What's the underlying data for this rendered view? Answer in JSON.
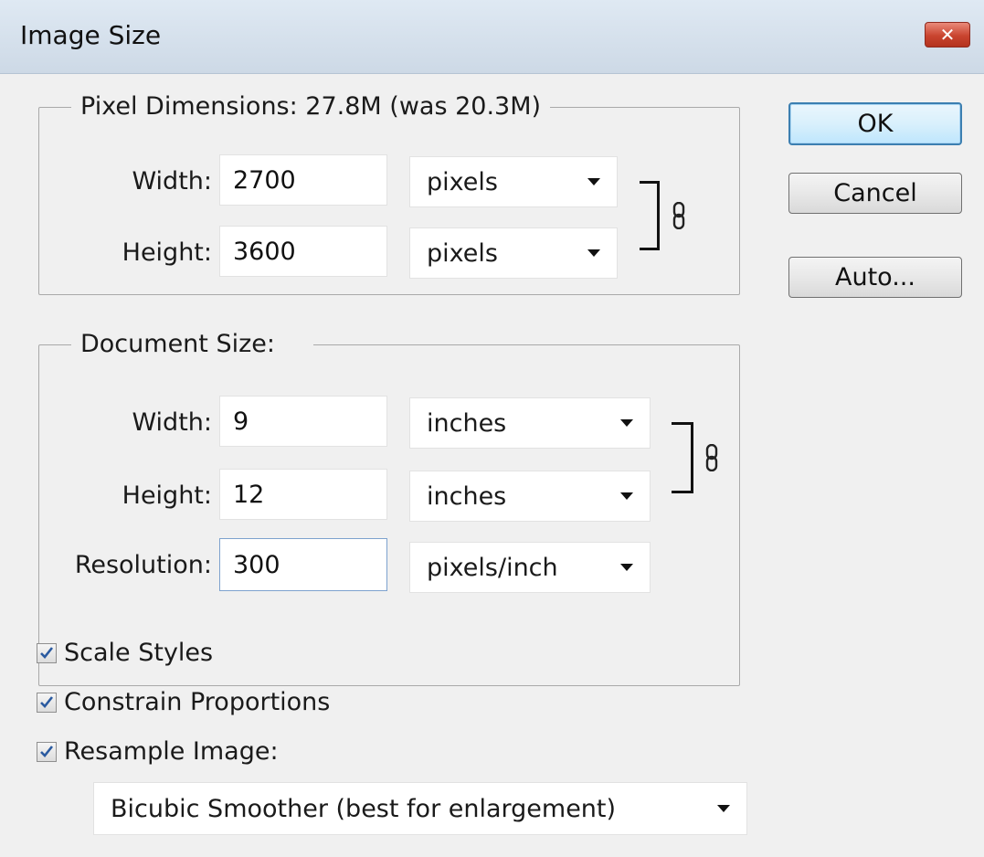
{
  "window": {
    "title": "Image Size",
    "close_label": "✕"
  },
  "pixel_dimensions": {
    "legend": "Pixel Dimensions:  27.8M (was 20.3M)",
    "width_label": "Width:",
    "width_value": "2700",
    "width_unit": "pixels",
    "height_label": "Height:",
    "height_value": "3600",
    "height_unit": "pixels"
  },
  "document_size": {
    "legend": "Document Size:",
    "width_label": "Width:",
    "width_value": "9",
    "width_unit": "inches",
    "height_label": "Height:",
    "height_value": "12",
    "height_unit": "inches",
    "resolution_label": "Resolution:",
    "resolution_value": "300",
    "resolution_unit": "pixels/inch"
  },
  "buttons": {
    "ok": "OK",
    "cancel": "Cancel",
    "auto": "Auto..."
  },
  "options": {
    "scale_styles": {
      "label": "Scale Styles",
      "checked": true
    },
    "constrain_proportions": {
      "label": "Constrain Proportions",
      "checked": true
    },
    "resample_image": {
      "label": "Resample Image:",
      "checked": true
    },
    "resample_method": "Bicubic Smoother (best for enlargement)"
  },
  "icons": {
    "link": "chain-link-icon",
    "check": "checkmark-icon",
    "dropdown": "chevron-down-icon",
    "close": "close-icon"
  },
  "colors": {
    "title_bar": "#dfe9f3",
    "close_button": "#c9442f",
    "default_button_border": "#3c7fb1",
    "checkmark": "#2a5aa0"
  }
}
